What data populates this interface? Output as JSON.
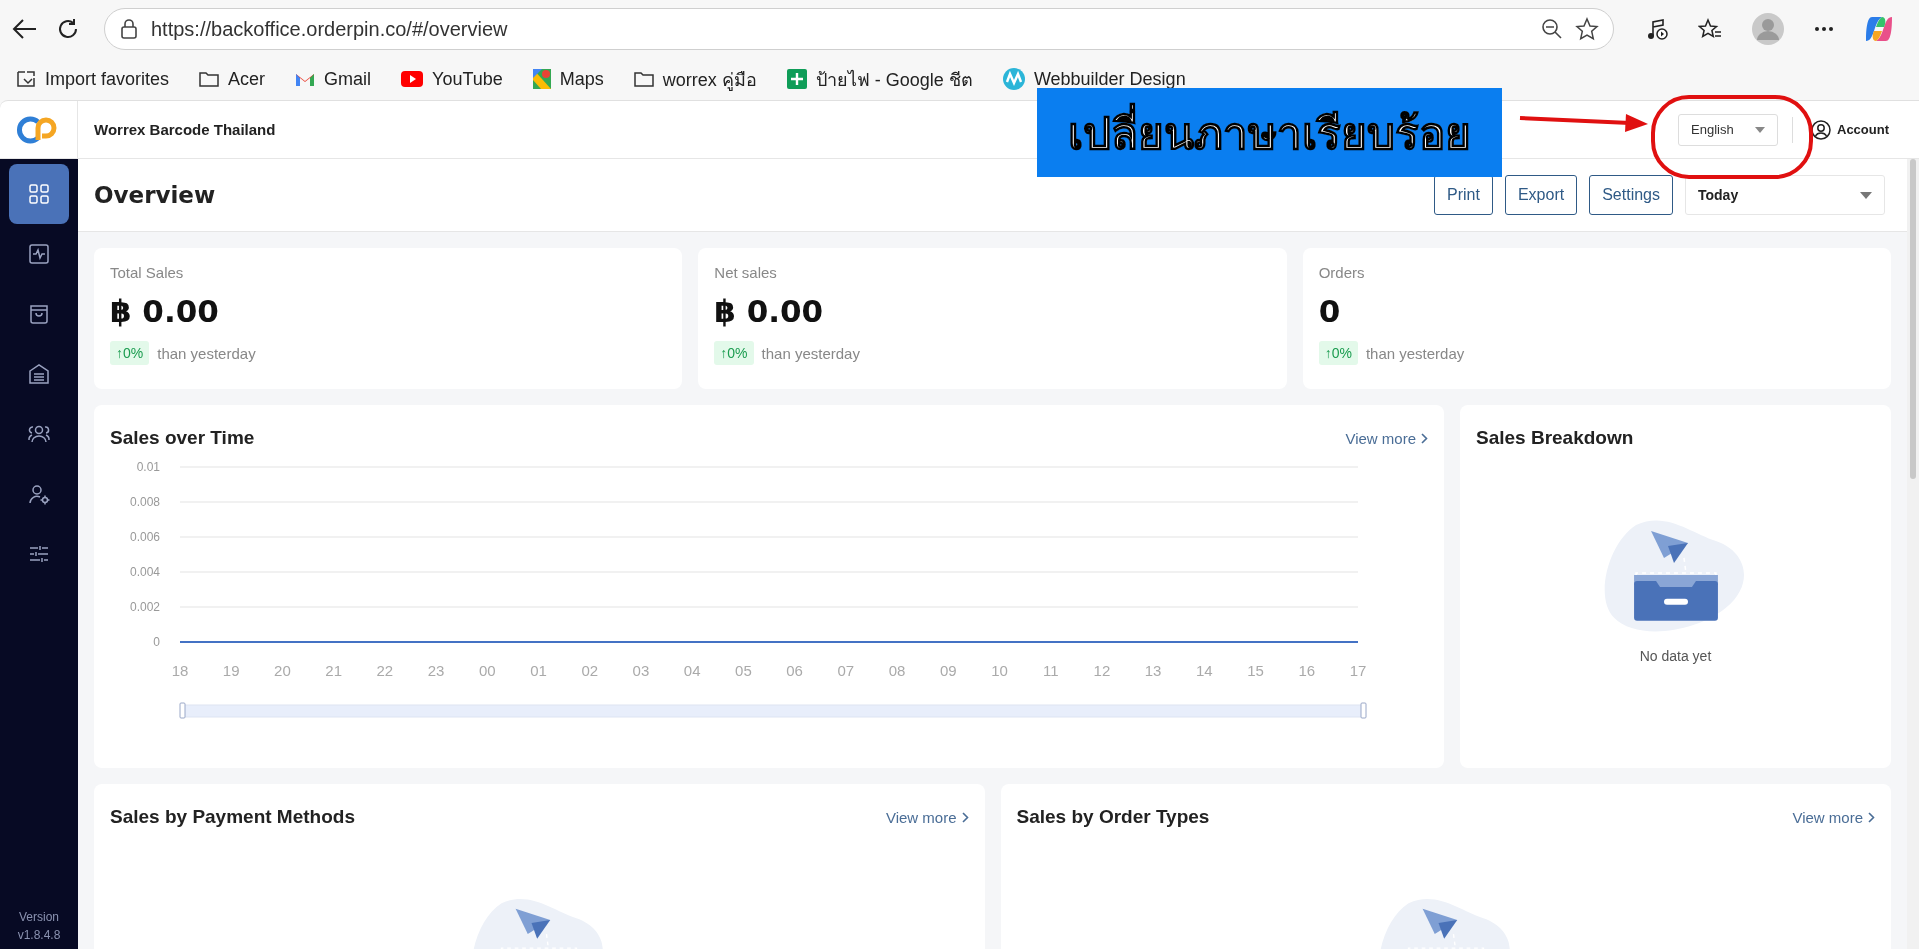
{
  "browser": {
    "url": "https://backoffice.orderpin.co/#/overview",
    "bookmarks": [
      {
        "kind": "import",
        "label": "Import favorites"
      },
      {
        "kind": "folder",
        "label": "Acer"
      },
      {
        "kind": "gmail",
        "label": "Gmail"
      },
      {
        "kind": "youtube",
        "label": "YouTube"
      },
      {
        "kind": "maps",
        "label": "Maps"
      },
      {
        "kind": "folder",
        "label": "worrex คู่มือ"
      },
      {
        "kind": "sheets",
        "label": "ป้ายไฟ - Google ชีต"
      },
      {
        "kind": "webbuilder",
        "label": "Webbuilder Design"
      }
    ]
  },
  "header": {
    "company": "Worrex Barcode Thailand",
    "language": "English",
    "account": "Account"
  },
  "annotation": {
    "text": "เปลี่ยนภาษาเรียบร้อย"
  },
  "sidebar": {
    "items": [
      {
        "selected": true
      },
      {
        "selected": false
      },
      {
        "selected": false
      },
      {
        "selected": false
      },
      {
        "selected": false
      },
      {
        "selected": false
      },
      {
        "selected": false
      }
    ],
    "version_label": "Version",
    "version": "v1.8.4.8"
  },
  "toolbar": {
    "title": "Overview",
    "buttons": [
      "Print",
      "Export",
      "Settings"
    ],
    "period": "Today"
  },
  "stats": [
    {
      "label": "Total Sales",
      "value": "฿ 0.00",
      "change": "↑0%",
      "note": "than yesterday"
    },
    {
      "label": "Net sales",
      "value": "฿ 0.00",
      "change": "↑0%",
      "note": "than yesterday"
    },
    {
      "label": "Orders",
      "value": "0",
      "change": "↑0%",
      "note": "than yesterday"
    }
  ],
  "sales_over_time": {
    "title": "Sales over Time",
    "link": "View more",
    "chart_data": {
      "type": "line",
      "x": [
        "18",
        "19",
        "20",
        "21",
        "22",
        "23",
        "00",
        "01",
        "02",
        "03",
        "04",
        "05",
        "06",
        "07",
        "08",
        "09",
        "10",
        "11",
        "12",
        "13",
        "14",
        "15",
        "16",
        "17"
      ],
      "series": [
        {
          "color": "#4472c4",
          "values": [
            0,
            0,
            0,
            0,
            0,
            0,
            0,
            0,
            0,
            0,
            0,
            0,
            0,
            0,
            0,
            0,
            0,
            0,
            0,
            0,
            0,
            0,
            0,
            0
          ]
        }
      ],
      "grid": true,
      "ylim": [
        0,
        0.01
      ],
      "yticks": [
        0,
        0.002,
        0.004,
        0.006,
        0.008,
        0.01
      ]
    }
  },
  "sales_breakdown": {
    "title": "Sales Breakdown",
    "empty_text": "No data yet"
  },
  "bottom_cards": [
    {
      "title": "Sales by Payment Methods",
      "link": "View more"
    },
    {
      "title": "Sales by Order Types",
      "link": "View more"
    }
  ]
}
